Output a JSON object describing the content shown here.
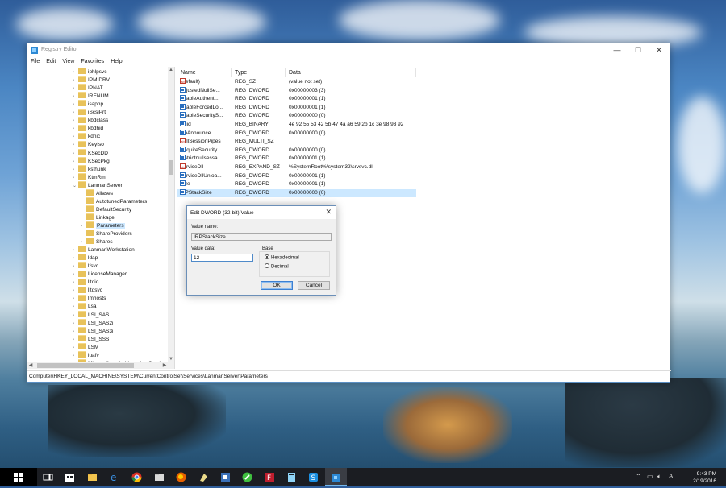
{
  "window": {
    "title": "Registry Editor",
    "minimize": "—",
    "maximize": "☐",
    "close": "✕"
  },
  "menu": [
    "File",
    "Edit",
    "View",
    "Favorites",
    "Help"
  ],
  "tree": [
    {
      "label": "iphlpsvc",
      "level": 1,
      "chevron": "›"
    },
    {
      "label": "IPMIDRV",
      "level": 1,
      "chevron": "›"
    },
    {
      "label": "IPNAT",
      "level": 1,
      "chevron": "›"
    },
    {
      "label": "IRENUM",
      "level": 1,
      "chevron": "›"
    },
    {
      "label": "isapnp",
      "level": 1,
      "chevron": "›"
    },
    {
      "label": "iScsiPrt",
      "level": 1,
      "chevron": "›"
    },
    {
      "label": "kbdclass",
      "level": 1,
      "chevron": "›"
    },
    {
      "label": "kbdhid",
      "level": 1,
      "chevron": "›"
    },
    {
      "label": "kdnic",
      "level": 1,
      "chevron": "›"
    },
    {
      "label": "KeyIso",
      "level": 1,
      "chevron": "›"
    },
    {
      "label": "KSecDD",
      "level": 1,
      "chevron": "›"
    },
    {
      "label": "KSecPkg",
      "level": 1,
      "chevron": "›"
    },
    {
      "label": "ksthunk",
      "level": 1,
      "chevron": "›"
    },
    {
      "label": "KtmRm",
      "level": 1,
      "chevron": "›"
    },
    {
      "label": "LanmanServer",
      "level": 1,
      "chevron": "⌄"
    },
    {
      "label": "Aliases",
      "level": 2,
      "chevron": ""
    },
    {
      "label": "AutotunedParameters",
      "level": 2,
      "chevron": ""
    },
    {
      "label": "DefaultSecurity",
      "level": 2,
      "chevron": ""
    },
    {
      "label": "Linkage",
      "level": 2,
      "chevron": ""
    },
    {
      "label": "Parameters",
      "level": 2,
      "chevron": "›",
      "selected": true
    },
    {
      "label": "ShareProviders",
      "level": 2,
      "chevron": ""
    },
    {
      "label": "Shares",
      "level": 2,
      "chevron": "›"
    },
    {
      "label": "LanmanWorkstation",
      "level": 1,
      "chevron": "›"
    },
    {
      "label": "ldap",
      "level": 1,
      "chevron": "›"
    },
    {
      "label": "lfsvc",
      "level": 1,
      "chevron": "›"
    },
    {
      "label": "LicenseManager",
      "level": 1,
      "chevron": "›"
    },
    {
      "label": "lltdio",
      "level": 1,
      "chevron": "›"
    },
    {
      "label": "lltdsvc",
      "level": 1,
      "chevron": "›"
    },
    {
      "label": "lmhosts",
      "level": 1,
      "chevron": "›"
    },
    {
      "label": "Lsa",
      "level": 1,
      "chevron": "›"
    },
    {
      "label": "LSI_SAS",
      "level": 1,
      "chevron": "›"
    },
    {
      "label": "LSI_SAS2i",
      "level": 1,
      "chevron": "›"
    },
    {
      "label": "LSI_SAS3i",
      "level": 1,
      "chevron": "›"
    },
    {
      "label": "LSI_SSS",
      "level": 1,
      "chevron": "›"
    },
    {
      "label": "LSM",
      "level": 1,
      "chevron": "›"
    },
    {
      "label": "luafv",
      "level": 1,
      "chevron": "›"
    },
    {
      "label": "Microsoftmedia Licensing Service",
      "level": 1,
      "chevron": "›"
    }
  ],
  "list": {
    "headers": {
      "name": "Name",
      "type": "Type",
      "data": "Data"
    },
    "rows": [
      {
        "name": "(Default)",
        "type": "REG_SZ",
        "data": "(value not set)",
        "icon": "string-value-icon"
      },
      {
        "name": "AdjustedNullSe...",
        "type": "REG_DWORD",
        "data": "0x00000003 (3)",
        "icon": "binary-value-icon"
      },
      {
        "name": "EnableAuthenti...",
        "type": "REG_DWORD",
        "data": "0x00000001 (1)",
        "icon": "binary-value-icon"
      },
      {
        "name": "EnableForcedLo...",
        "type": "REG_DWORD",
        "data": "0x00000001 (1)",
        "icon": "binary-value-icon"
      },
      {
        "name": "EnableSecurityS...",
        "type": "REG_DWORD",
        "data": "0x00000000 (0)",
        "icon": "binary-value-icon"
      },
      {
        "name": "Guid",
        "type": "REG_BINARY",
        "data": "4e 92 55 53 42 5b 47 4a a6 59 2b 1c 3e 98 93 92",
        "icon": "binary-value-icon"
      },
      {
        "name": "LmAnnounce",
        "type": "REG_DWORD",
        "data": "0x00000000 (0)",
        "icon": "binary-value-icon"
      },
      {
        "name": "NullSessionPipes",
        "type": "REG_MULTI_SZ",
        "data": "",
        "icon": "string-value-icon"
      },
      {
        "name": "RequireSecurity...",
        "type": "REG_DWORD",
        "data": "0x00000000 (0)",
        "icon": "binary-value-icon"
      },
      {
        "name": "restrictnullsessa...",
        "type": "REG_DWORD",
        "data": "0x00000001 (1)",
        "icon": "binary-value-icon"
      },
      {
        "name": "ServiceDll",
        "type": "REG_EXPAND_SZ",
        "data": "%SystemRoot%\\system32\\srvsvc.dll",
        "icon": "string-value-icon"
      },
      {
        "name": "ServiceDllUnloa...",
        "type": "REG_DWORD",
        "data": "0x00000001 (1)",
        "icon": "binary-value-icon"
      },
      {
        "name": "Size",
        "type": "REG_DWORD",
        "data": "0x00000001 (1)",
        "icon": "binary-value-icon"
      },
      {
        "name": "IRPStackSize",
        "type": "REG_DWORD",
        "data": "0x00000000 (0)",
        "icon": "binary-value-icon",
        "selected": true
      }
    ]
  },
  "status_path": "Computer\\HKEY_LOCAL_MACHINE\\SYSTEM\\CurrentControlSet\\Services\\LanmanServer\\Parameters",
  "dialog": {
    "title": "Edit DWORD (32-bit) Value",
    "close": "✕",
    "value_name_label": "Value name:",
    "value_name": "IRPStackSize",
    "value_data_label": "Value data:",
    "value_data": "12",
    "base_label": "Base",
    "hex_label": "Hexadecimal",
    "dec_label": "Decimal",
    "selected_base": "Hexadecimal",
    "ok": "OK",
    "cancel": "Cancel"
  },
  "taskbar": {
    "time": "9:43 PM",
    "date": "2/19/2016",
    "language": "A",
    "accent": "#76b9ed"
  }
}
